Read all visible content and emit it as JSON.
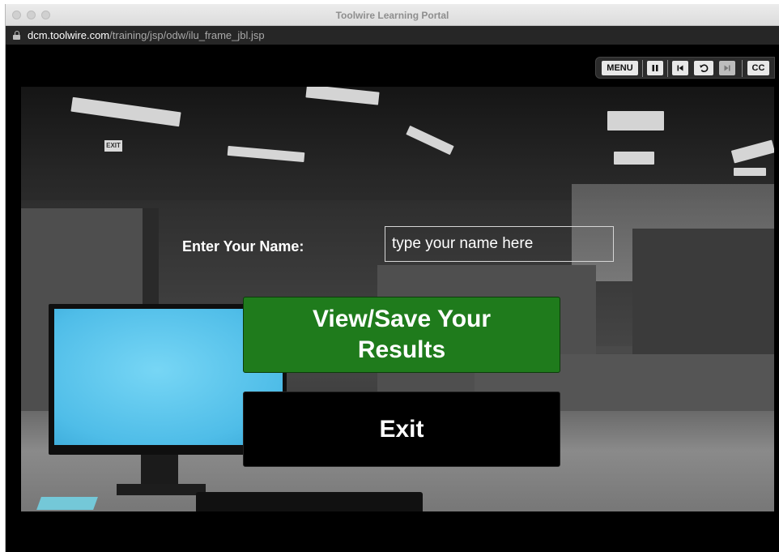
{
  "window": {
    "title": "Toolwire Learning Portal"
  },
  "address_bar": {
    "host": "dcm.toolwire.com",
    "path": "/training/jsp/odw/ilu_frame_jbl.jsp",
    "icon": "lock-icon"
  },
  "player_controls": {
    "menu_label": "MENU",
    "pause_icon": "pause-icon",
    "skip_back_icon": "skip-back-icon",
    "replay_icon": "replay-icon",
    "skip_forward_icon": "skip-forward-icon",
    "cc_label": "CC"
  },
  "scene": {
    "exit_sign": "EXIT"
  },
  "form": {
    "name_label": "Enter Your Name:",
    "name_placeholder": "type your name here",
    "name_value": ""
  },
  "buttons": {
    "view_save_label": "View/Save Your Results",
    "exit_label": "Exit"
  },
  "colors": {
    "view_button": "#1f7b1c",
    "exit_button": "#000000",
    "screen_blue": "#4fbde8"
  }
}
